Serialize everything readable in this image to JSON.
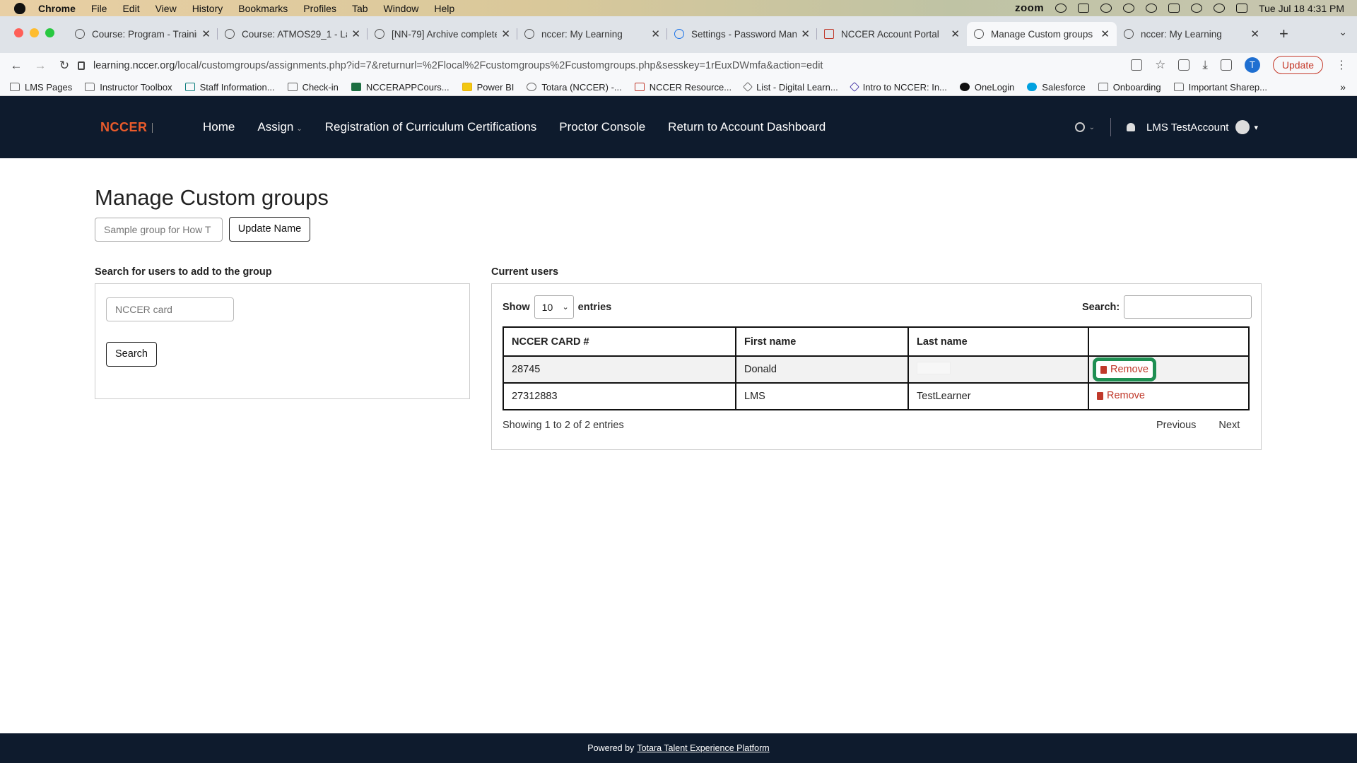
{
  "menubar": {
    "app": "Chrome",
    "items": [
      "File",
      "Edit",
      "View",
      "History",
      "Bookmarks",
      "Profiles",
      "Tab",
      "Window",
      "Help"
    ],
    "zoom": "zoom",
    "datetime": "Tue Jul 18  4:31 PM"
  },
  "tabs": [
    {
      "title": "Course: Program - Trainin",
      "icon": "globe-icon"
    },
    {
      "title": "Course: ATMOS29_1 - La",
      "icon": "globe-icon"
    },
    {
      "title": "[NN-79] Archive complete",
      "icon": "globe-icon"
    },
    {
      "title": "nccer: My Learning",
      "icon": "globe-icon"
    },
    {
      "title": "Settings - Password Mana",
      "icon": "gear-icon"
    },
    {
      "title": "NCCER Account Portal",
      "icon": "nccer-icon"
    },
    {
      "title": "Manage Custom groups",
      "icon": "globe-icon",
      "active": true
    },
    {
      "title": "nccer: My Learning",
      "icon": "globe-icon"
    }
  ],
  "address": {
    "host": "learning.nccer.org",
    "path": "/local/customgroups/assignments.php?id=7&returnurl=%2Flocal%2Fcustomgroups%2Fcustomgroups.php&sesskey=1rEuxDWmfa&action=edit",
    "update_label": "Update",
    "profile_initial": "T"
  },
  "bookmarks": [
    "LMS Pages",
    "Instructor Toolbox",
    "Staff Information...",
    "Check-in",
    "NCCERAPPCours...",
    "Power BI",
    "Totara (NCCER) -...",
    "NCCER Resource...",
    "List - Digital Learn...",
    "Intro to NCCER: In...",
    "OneLogin",
    "Salesforce",
    "Onboarding",
    "Important Sharep..."
  ],
  "site": {
    "logo": "NCCER",
    "nav": [
      "Home",
      "Assign",
      "Registration of Curriculum Certifications",
      "Proctor Console",
      "Return to Account Dashboard"
    ],
    "user": "LMS TestAccount"
  },
  "page": {
    "title": "Manage Custom groups",
    "group_name_value": "Sample group for How T",
    "update_name_label": "Update Name",
    "search_section_label": "Search for users to add to the group",
    "card_placeholder": "NCCER card",
    "search_button": "Search",
    "current_users_label": "Current users",
    "show_label": "Show",
    "entries_value": "10",
    "entries_label": "entries",
    "search_label": "Search:",
    "columns": [
      "NCCER CARD #",
      "First name",
      "Last name",
      ""
    ],
    "rows": [
      {
        "card": "28745",
        "first": "Donald",
        "last": "",
        "action": "Remove"
      },
      {
        "card": "27312883",
        "first": "LMS",
        "last": "TestLearner",
        "action": "Remove"
      }
    ],
    "info": "Showing 1 to 2 of 2 entries",
    "prev": "Previous",
    "next": "Next"
  },
  "footer": {
    "prefix": "Powered by",
    "link": "Totara Talent Experience Platform"
  },
  "colors": {
    "nav_bg": "#0e1b2d",
    "accent_remove": "#c0392b",
    "highlight": "#1e8f52",
    "logo": "#ea5b2b"
  }
}
